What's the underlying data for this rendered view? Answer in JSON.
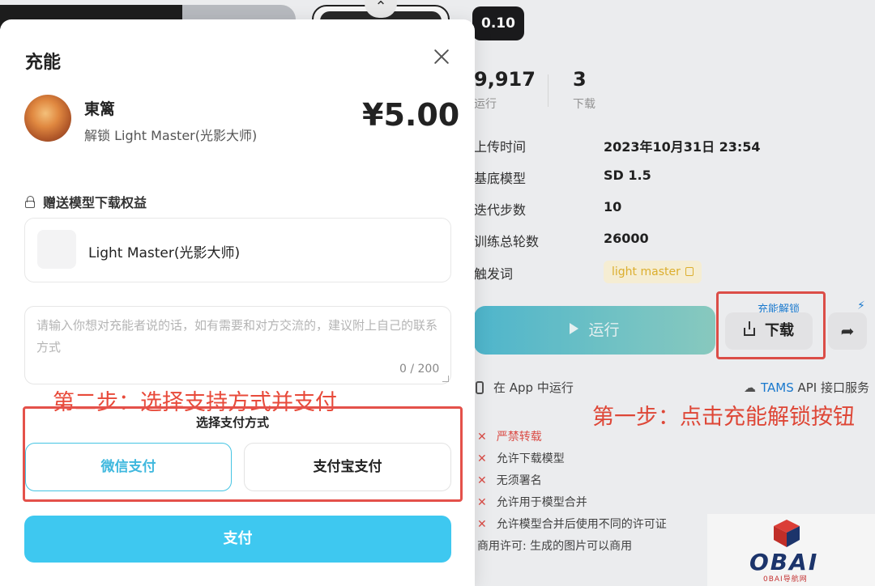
{
  "background": {
    "version": "0.10",
    "stats": [
      {
        "value": "9,917",
        "label": "运行"
      },
      {
        "value": "3",
        "label": "下载"
      }
    ],
    "info": [
      {
        "key": "上传时间",
        "value": "2023年10月31日 23:54"
      },
      {
        "key": "基底模型",
        "value": "SD 1.5"
      },
      {
        "key": "迭代步数",
        "value": "10"
      },
      {
        "key": "训练总轮数",
        "value": "26000"
      },
      {
        "key": "触发词",
        "value": "light master"
      }
    ],
    "run_label": "运行",
    "unlock_label": "充能解锁",
    "download_label": "下载",
    "app_run": "在 App 中运行",
    "tams_brand": "TAMS",
    "tams_rest": " API 接口服务",
    "permissions": [
      "严禁转载",
      "允许下载模型",
      "无须署名",
      "允许用于模型合并",
      "允许模型合并后使用不同的许可证"
    ],
    "license": "商用许可: 生成的图片可以商用"
  },
  "annotations": {
    "step1": "第一步：点击充能解锁按钮",
    "step2": "第二步：选择支持方式并支付"
  },
  "watermark": {
    "brand": "OBAI",
    "sub": "0BAI导航网"
  },
  "modal": {
    "title": "充能",
    "creator": "東篱",
    "unlock_desc": "解锁 Light Master(光影大师)",
    "price": "¥5.00",
    "gift_title": "赠送模型下载权益",
    "gift_name": "Light Master(光影大师)",
    "message_placeholder": "请输入你想对充能者说的话，如有需要和对方交流的，建议附上自己的联系方式",
    "message_count": "0 / 200",
    "pay_method_title": "选择支付方式",
    "pay_wechat": "微信支付",
    "pay_alipay": "支付宝支付",
    "pay_button": "支付"
  }
}
